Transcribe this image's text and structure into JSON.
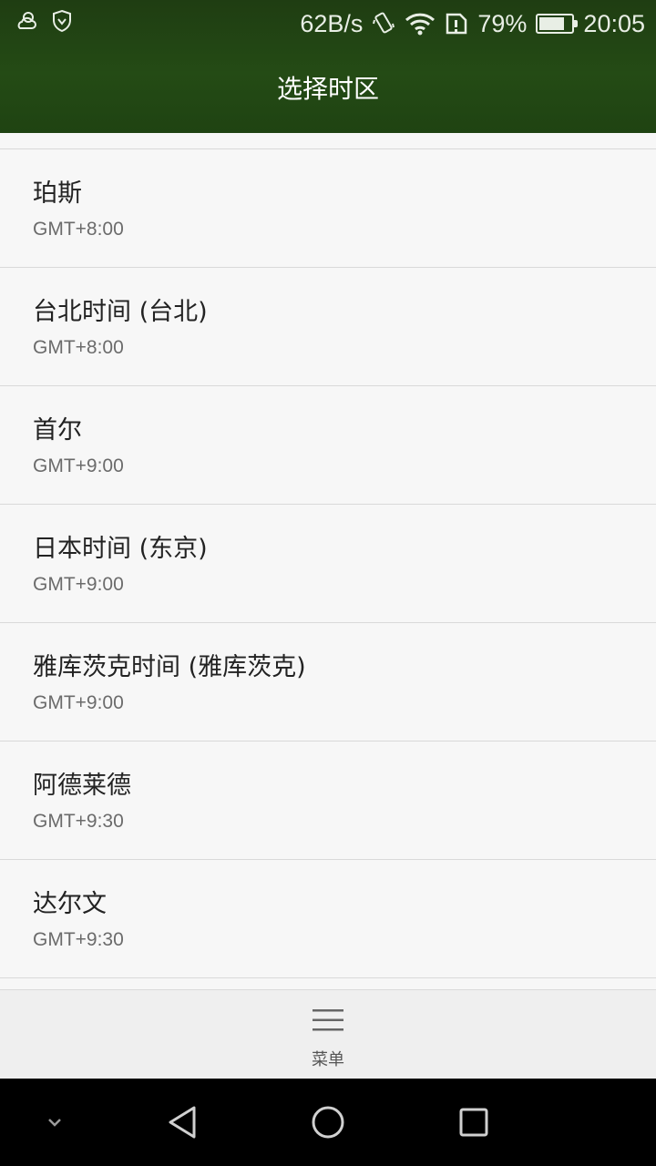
{
  "status_bar": {
    "net_speed": "62B/s",
    "battery_percent": "79%",
    "battery_level": 0.79,
    "time": "20:05",
    "icons": [
      "cloud-weather-icon",
      "shield-icon",
      "vibrate-icon",
      "wifi-icon",
      "sim-alert-icon",
      "battery-icon"
    ]
  },
  "header": {
    "title": "选择时区"
  },
  "timezones": [
    {
      "name": "珀斯",
      "offset": "GMT+8:00"
    },
    {
      "name": "台北时间 (台北)",
      "offset": "GMT+8:00"
    },
    {
      "name": "首尔",
      "offset": "GMT+9:00"
    },
    {
      "name": "日本时间 (东京)",
      "offset": "GMT+9:00"
    },
    {
      "name": "雅库茨克时间 (雅库茨克)",
      "offset": "GMT+9:00"
    },
    {
      "name": "阿德莱德",
      "offset": "GMT+9:30"
    },
    {
      "name": "达尔文",
      "offset": "GMT+9:30"
    }
  ],
  "bottom_bar": {
    "menu_label": "菜单",
    "menu_icon": "hamburger-menu-icon"
  },
  "nav_bar": {
    "icons": [
      "chevron-down-icon",
      "back-triangle-icon",
      "home-circle-icon",
      "recents-square-icon"
    ]
  },
  "colors": {
    "header_bg": "#244b15",
    "list_bg": "#f7f7f7",
    "primary_text": "#222222",
    "secondary_text": "#6b6b6b"
  }
}
